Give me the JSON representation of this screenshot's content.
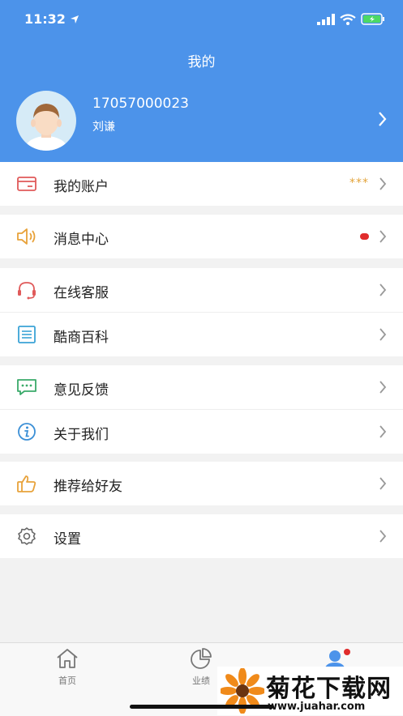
{
  "status_bar": {
    "time": "11:32"
  },
  "header": {
    "title": "我的"
  },
  "profile": {
    "phone": "17057000023",
    "name": "刘谦"
  },
  "menu": {
    "account": {
      "label": "我的账户",
      "value": "***"
    },
    "messages": {
      "label": "消息中心"
    },
    "service": {
      "label": "在线客服"
    },
    "wiki": {
      "label": "酷商百科"
    },
    "feedback": {
      "label": "意见反馈"
    },
    "about": {
      "label": "关于我们"
    },
    "recommend": {
      "label": "推荐给好友"
    },
    "settings": {
      "label": "设置"
    }
  },
  "tabbar": {
    "home": {
      "label": "首页"
    },
    "performance": {
      "label": "业绩"
    }
  },
  "watermark": {
    "title": "菊花下载网",
    "url": "www.juahar.com"
  },
  "colors": {
    "primary": "#4c93ea",
    "badge": "#e02c2c",
    "stars": "#e3a33a"
  },
  "icons": [
    "location-arrow-icon",
    "signal-icon",
    "wifi-icon",
    "battery-icon",
    "avatar",
    "chevron-right-icon",
    "card-icon",
    "speaker-icon",
    "headset-icon",
    "document-icon",
    "chat-icon",
    "info-icon",
    "thumbs-up-icon",
    "gear-icon",
    "home-icon",
    "pie-chart-icon",
    "user-icon"
  ]
}
